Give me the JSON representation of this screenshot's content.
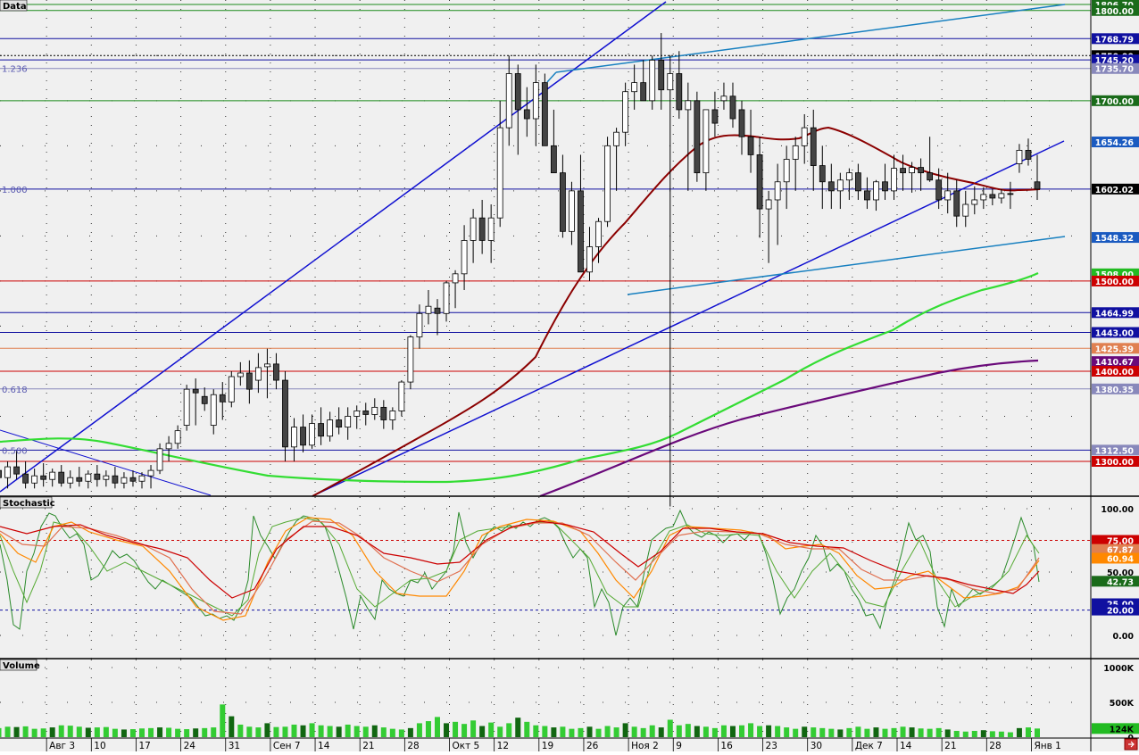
{
  "panes": {
    "price": {
      "title": "Data"
    },
    "stochastic": {
      "title": "Stochastic"
    },
    "volume": {
      "title": "Volume"
    }
  },
  "chart_data": [
    {
      "type": "candlestick",
      "title": "Data",
      "ylim": [
        1270,
        1815
      ],
      "x_tick_labels": [
        "Авг 3",
        "10",
        "17",
        "24",
        "31",
        "Сен 7",
        "14",
        "21",
        "28",
        "Окт 5",
        "12",
        "19",
        "26",
        "Ноя 2",
        "9",
        "16",
        "23",
        "30",
        "Дек 7",
        "14",
        "21",
        "28",
        "Янв 1"
      ],
      "x_tick_index": [
        5,
        10,
        15,
        20,
        25,
        30,
        35,
        40,
        45,
        50,
        55,
        60,
        65,
        70,
        75,
        80,
        85,
        90,
        95,
        100,
        105,
        110,
        115
      ],
      "candles": [
        [
          1288,
          1302,
          1270,
          1298
        ],
        [
          1298,
          1318,
          1290,
          1312
        ],
        [
          1312,
          1325,
          1298,
          1305
        ],
        [
          1305,
          1320,
          1288,
          1294
        ],
        [
          1294,
          1312,
          1280,
          1308
        ],
        [
          1308,
          1322,
          1280,
          1292
        ],
        [
          1292,
          1298,
          1270,
          1276
        ],
        [
          1276,
          1296,
          1270,
          1290
        ],
        [
          1290,
          1305,
          1272,
          1282
        ],
        [
          1282,
          1300,
          1270,
          1294
        ],
        [
          1294,
          1312,
          1280,
          1286
        ],
        [
          1286,
          1300,
          1270,
          1276
        ],
        [
          1276,
          1292,
          1270,
          1284
        ],
        [
          1284,
          1298,
          1272,
          1280
        ],
        [
          1280,
          1292,
          1272,
          1288
        ],
        [
          1288,
          1296,
          1272,
          1276
        ],
        [
          1276,
          1290,
          1270,
          1282
        ],
        [
          1282,
          1294,
          1272,
          1278
        ],
        [
          1278,
          1290,
          1270,
          1286
        ],
        [
          1286,
          1296,
          1272,
          1280
        ],
        [
          1280,
          1290,
          1272,
          1284
        ],
        [
          1284,
          1294,
          1270,
          1276
        ],
        [
          1276,
          1288,
          1270,
          1282
        ],
        [
          1282,
          1290,
          1272,
          1278
        ],
        [
          1278,
          1288,
          1270,
          1284
        ],
        [
          1284,
          1296,
          1270,
          1290
        ],
        [
          1290,
          1320,
          1286,
          1314
        ],
        [
          1314,
          1328,
          1300,
          1320
        ],
        [
          1320,
          1340,
          1314,
          1334
        ],
        [
          1340,
          1385,
          1334,
          1380
        ],
        [
          1380,
          1392,
          1340,
          1376
        ],
        [
          1372,
          1382,
          1356,
          1364
        ],
        [
          1340,
          1380,
          1330,
          1374
        ],
        [
          1374,
          1388,
          1346,
          1366
        ],
        [
          1366,
          1400,
          1360,
          1394
        ],
        [
          1394,
          1410,
          1384,
          1398
        ],
        [
          1398,
          1412,
          1364,
          1380
        ],
        [
          1390,
          1420,
          1376,
          1404
        ],
        [
          1405,
          1425,
          1370,
          1408
        ],
        [
          1408,
          1420,
          1380,
          1390
        ],
        [
          1390,
          1400,
          1300,
          1316
        ],
        [
          1316,
          1348,
          1300,
          1338
        ],
        [
          1338,
          1352,
          1310,
          1318
        ],
        [
          1318,
          1352,
          1314,
          1342
        ],
        [
          1342,
          1360,
          1318,
          1328
        ],
        [
          1328,
          1355,
          1322,
          1346
        ],
        [
          1346,
          1360,
          1330,
          1338
        ],
        [
          1338,
          1360,
          1324,
          1350
        ],
        [
          1350,
          1362,
          1336,
          1356
        ],
        [
          1356,
          1365,
          1340,
          1352
        ],
        [
          1352,
          1370,
          1346,
          1360
        ],
        [
          1360,
          1368,
          1336,
          1346
        ],
        [
          1346,
          1360,
          1335,
          1356
        ],
        [
          1356,
          1390,
          1350,
          1388
        ],
        [
          1388,
          1440,
          1380,
          1438
        ],
        [
          1438,
          1474,
          1425,
          1464
        ],
        [
          1464,
          1490,
          1452,
          1472
        ],
        [
          1470,
          1480,
          1440,
          1464
        ],
        [
          1464,
          1500,
          1455,
          1498
        ],
        [
          1498,
          1512,
          1470,
          1508
        ],
        [
          1508,
          1562,
          1490,
          1545
        ],
        [
          1545,
          1580,
          1520,
          1570
        ],
        [
          1570,
          1590,
          1530,
          1545
        ],
        [
          1545,
          1585,
          1520,
          1570
        ],
        [
          1570,
          1700,
          1560,
          1670
        ],
        [
          1670,
          1750,
          1650,
          1730
        ],
        [
          1730,
          1740,
          1640,
          1690
        ],
        [
          1690,
          1715,
          1660,
          1680
        ],
        [
          1680,
          1740,
          1650,
          1720
        ],
        [
          1720,
          1730,
          1660,
          1650
        ],
        [
          1650,
          1690,
          1630,
          1620
        ],
        [
          1620,
          1640,
          1548,
          1555
        ],
        [
          1555,
          1610,
          1540,
          1600
        ],
        [
          1600,
          1640,
          1530,
          1510
        ],
        [
          1510,
          1560,
          1500,
          1538
        ],
        [
          1538,
          1570,
          1520,
          1566
        ],
        [
          1566,
          1660,
          1560,
          1650
        ],
        [
          1650,
          1670,
          1600,
          1665
        ],
        [
          1665,
          1720,
          1650,
          1710
        ],
        [
          1710,
          1740,
          1690,
          1720
        ],
        [
          1720,
          1745,
          1700,
          1700
        ],
        [
          1700,
          1750,
          1690,
          1745
        ],
        [
          1745,
          1775,
          1690,
          1712
        ],
        [
          1712,
          1750,
          1250,
          1730
        ],
        [
          1730,
          1755,
          1680,
          1690
        ],
        [
          1690,
          1720,
          1600,
          1700
        ],
        [
          1700,
          1710,
          1610,
          1620
        ],
        [
          1620,
          1680,
          1600,
          1690
        ],
        [
          1690,
          1710,
          1660,
          1675
        ],
        [
          1700,
          1720,
          1690,
          1705
        ],
        [
          1705,
          1720,
          1670,
          1680
        ],
        [
          1690,
          1700,
          1640,
          1660
        ],
        [
          1660,
          1690,
          1620,
          1640
        ],
        [
          1640,
          1660,
          1548,
          1580
        ],
        [
          1580,
          1600,
          1520,
          1590
        ],
        [
          1590,
          1630,
          1540,
          1610
        ],
        [
          1610,
          1650,
          1580,
          1635
        ],
        [
          1635,
          1660,
          1600,
          1650
        ],
        [
          1650,
          1685,
          1630,
          1670
        ],
        [
          1670,
          1690,
          1600,
          1628
        ],
        [
          1628,
          1650,
          1580,
          1610
        ],
        [
          1610,
          1630,
          1580,
          1600
        ],
        [
          1600,
          1620,
          1580,
          1612
        ],
        [
          1612,
          1625,
          1590,
          1620
        ],
        [
          1620,
          1630,
          1590,
          1600
        ],
        [
          1600,
          1615,
          1580,
          1590
        ],
        [
          1590,
          1612,
          1578,
          1610
        ],
        [
          1610,
          1630,
          1590,
          1600
        ],
        [
          1600,
          1640,
          1590,
          1625
        ],
        [
          1625,
          1640,
          1600,
          1620
        ],
        [
          1620,
          1632,
          1598,
          1626
        ],
        [
          1626,
          1636,
          1600,
          1620
        ],
        [
          1620,
          1660,
          1610,
          1612
        ],
        [
          1612,
          1625,
          1580,
          1590
        ],
        [
          1590,
          1620,
          1575,
          1600
        ],
        [
          1600,
          1612,
          1560,
          1572
        ],
        [
          1572,
          1600,
          1560,
          1585
        ],
        [
          1585,
          1605,
          1574,
          1590
        ],
        [
          1590,
          1604,
          1580,
          1596
        ],
        [
          1596,
          1602,
          1584,
          1592
        ],
        [
          1592,
          1602,
          1586,
          1597
        ],
        [
          1597,
          1610,
          1580,
          1596
        ],
        [
          1630,
          1652,
          1620,
          1645
        ],
        [
          1645,
          1658,
          1628,
          1635
        ],
        [
          1610,
          1640,
          1590,
          1602
        ]
      ],
      "indicators": [
        {
          "name": "MA short (dark red)",
          "color": "#8b0000"
        },
        {
          "name": "MA medium (green)",
          "color": "#33dd33"
        },
        {
          "name": "MA long (purple)",
          "color": "#6a0a7a"
        }
      ],
      "levels": [
        {
          "value": 1806.7,
          "label": "1806.70",
          "bg": "#1a6b1a",
          "line": "#1a8a1a"
        },
        {
          "value": 1800.0,
          "label": "1800.00",
          "bg": "#1a6b1a",
          "line": "#1a8a1a"
        },
        {
          "value": 1768.79,
          "label": "1768.79",
          "bg": "#1010a0",
          "line": "#1010a0"
        },
        {
          "value": 1750.0,
          "label": "1750.00",
          "bg": "#000000",
          "line": "#000000",
          "dotted": true
        },
        {
          "value": 1745.2,
          "label": "1745.20",
          "bg": "#1010a0",
          "line": "#1010a0"
        },
        {
          "value": 1735.7,
          "label": "1735.70",
          "bg": "#8888bb",
          "line": "#8888bb"
        },
        {
          "value": 1700.0,
          "label": "1700.00",
          "bg": "#1a6b1a",
          "line": "#1a8a1a"
        },
        {
          "value": 1654.26,
          "label": "1654.26",
          "bg": "#1a5ac0",
          "line": null
        },
        {
          "value": 1602.02,
          "label": "1602.02",
          "bg": "#000000",
          "line": "#1010a0"
        },
        {
          "value": 1548.32,
          "label": "1548.32",
          "bg": "#1a5ac0",
          "line": null
        },
        {
          "value": 1508.0,
          "label": "1508.00",
          "bg": "#22bb22",
          "line": null
        },
        {
          "value": 1500.0,
          "label": "1500.00",
          "bg": "#cc0000",
          "line": "#cc0000"
        },
        {
          "value": 1464.99,
          "label": "1464.99",
          "bg": "#1010a0",
          "line": "#1010a0"
        },
        {
          "value": 1443.0,
          "label": "1443.00",
          "bg": "#1010a0",
          "line": "#1010a0"
        },
        {
          "value": 1425.39,
          "label": "1425.39",
          "bg": "#e08050",
          "line": "#e08050"
        },
        {
          "value": 1410.67,
          "label": "1410.67",
          "bg": "#6a0a7a",
          "line": null
        },
        {
          "value": 1400.0,
          "label": "1400.00",
          "bg": "#cc0000",
          "line": "#cc0000"
        },
        {
          "value": 1380.35,
          "label": "1380.35",
          "bg": "#8888bb",
          "line": "#8888bb"
        },
        {
          "value": 1312.5,
          "label": "1312.50",
          "bg": "#8888bb",
          "line": "#1010a0"
        },
        {
          "value": 1300.0,
          "label": "1300.00",
          "bg": "#cc0000",
          "line": "#cc0000"
        }
      ],
      "fib_labels": [
        {
          "text": "1.236",
          "value": 1735.7
        },
        {
          "text": "1.000",
          "value": 1602.02
        },
        {
          "text": "0.618",
          "value": 1380.35
        },
        {
          "text": "0.500",
          "value": 1312.5
        }
      ]
    },
    {
      "type": "line",
      "title": "Stochastic",
      "ylim": [
        0,
        105
      ],
      "y_ticks": [
        "100.00",
        "50.00",
        "0.00"
      ],
      "levels": [
        {
          "value": 75.0,
          "label": "75.00",
          "bg": "#cc0000",
          "line": "#cc0000",
          "dashed": true
        },
        {
          "value": 67.87,
          "label": "67.87",
          "bg": "#e08050",
          "line": null
        },
        {
          "value": 60.94,
          "label": "60.94",
          "bg": "#ff8800",
          "line": null
        },
        {
          "value": 42.73,
          "label": "42.73",
          "bg": "#1a6b1a",
          "line": null
        },
        {
          "value": 25.0,
          "label": "25.00",
          "bg": "#1010a0",
          "line": null
        },
        {
          "value": 20.0,
          "label": "20.00",
          "bg": "#1010a0",
          "line": "#1010a0",
          "dashed": true
        }
      ]
    },
    {
      "type": "bar",
      "title": "Volume",
      "ylim": [
        0,
        1000
      ],
      "y_ticks": [
        "1000K",
        "500K",
        "0"
      ],
      "last_value_label": "124K"
    }
  ]
}
